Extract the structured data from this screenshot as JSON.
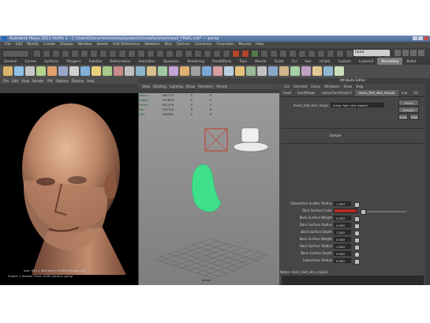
{
  "window": {
    "title": "Autodesk Maya 2011 Hotfix 1 · C:\\Users\\Documents\\maya\\projects\\head\\scenes\\head_FINAL.mb* — persp"
  },
  "menubar": [
    "File",
    "Edit",
    "Modify",
    "Create",
    "Display",
    "Window",
    "Assets",
    "Edit Deformers",
    "Skeleton",
    "Skin",
    "Deform",
    "Constrain",
    "Character",
    "Muscle",
    "Help"
  ],
  "status_line": {
    "mode": "Rendering",
    "input_value": "head"
  },
  "shelf_tabs": [
    "General",
    "Curves",
    "Surfaces",
    "Polygons",
    "Subdivs",
    "Deformation",
    "Animation",
    "Dynamics",
    "Rendering",
    "PaintEffects",
    "Toon",
    "Muscle",
    "Fluids",
    "Fur",
    "Hair",
    "nCloth",
    "Custom",
    "Custom2",
    "MentalRay",
    "Bullet"
  ],
  "shelf_active_tab": "MentalRay",
  "shelf_icon_colors": [
    "#d9b36a",
    "#8fc2e6",
    "#c7c7c7",
    "#b4d28a",
    "#e0a06a",
    "#9aa6c9",
    "#cfcfcf",
    "#7fb0d8",
    "#e8d07a",
    "#a8c98a",
    "#c98a8a",
    "#bfbfbf",
    "#8ab4c9",
    "#d7c08c",
    "#9fc99f",
    "#c4a4d8",
    "#e0b070",
    "#a0a0a0",
    "#7aa8d6",
    "#d8a0a0",
    "#b8d0e0",
    "#e6c27a",
    "#9ab89a",
    "#c0c0c0",
    "#88a8c8",
    "#d2b48c",
    "#a6d0a6",
    "#c0a0c0",
    "#e0c890",
    "#8fb8d0",
    "#cdb"
  ],
  "render_view": {
    "menu": [
      "File",
      "Edit",
      "View",
      "Render",
      "IPR",
      "Options",
      "Display",
      "Help"
    ],
    "hud_line1": "size: 640 x 480  zoom: 0.530  (mental ray)",
    "hud_line2": "Frame: 1   Render Time: 0:08   Camera: persp"
  },
  "viewport": {
    "menu": [
      "View",
      "Shading",
      "Lighting",
      "Show",
      "Renderer",
      "Panels"
    ],
    "stats": [
      {
        "name": "Verts:",
        "a": "161174",
        "b": "0",
        "c": "0"
      },
      {
        "name": "Edges:",
        "a": "322848",
        "b": "0",
        "c": "0"
      },
      {
        "name": "Faces:",
        "a": "161476",
        "b": "0",
        "c": "0"
      },
      {
        "name": "Tris:",
        "a": "322744",
        "b": "0",
        "c": "0"
      },
      {
        "name": "UVs:",
        "a": "166580",
        "b": "0",
        "c": "0"
      }
    ],
    "camera_label": "persp",
    "colors": {
      "mesh": "#3fe08a",
      "light_box": "#b84a3a"
    }
  },
  "attribute_editor": {
    "title": "Attribute Editor",
    "menu": [
      "List",
      "Selected",
      "Focus",
      "Attributes",
      "Show",
      "Help"
    ],
    "tabs": [
      "head",
      "headShape",
      "subsurfaceShader1",
      "misss_fast_skin_maya1",
      "mia",
      "SG"
    ],
    "active_tab": "misss_fast_skin_maya1",
    "node_label": "misss_fast_skin_maya:",
    "node_value": "misss_fast_skin_maya1",
    "buttons": {
      "focus": "Focus",
      "presets": "Presets",
      "show": "Show",
      "hide": "Hide"
    },
    "sample_label": "Sample",
    "attrs": [
      {
        "label": "Subsurface Scatter Radius",
        "value": "1.000"
      },
      {
        "label": "Back Surface Color",
        "value": ""
      },
      {
        "label": "Back Surface Weight",
        "value": "0.450"
      },
      {
        "label": "Back Surface Radius",
        "value": "4.000"
      },
      {
        "label": "Back Surface Depth",
        "value": "1.000"
      },
      {
        "label": "Back Surface Weight",
        "value": "0.000"
      },
      {
        "label": "Back Surface Radius",
        "value": "1.000"
      },
      {
        "label": "Back Surface Depth",
        "value": "0.500"
      },
      {
        "label": "Subsurface Radius",
        "value": "0.000"
      }
    ],
    "back_surface_color": "#b22a1e",
    "notes_label": "Notes:  misss_fast_skin_maya1",
    "bottom_buttons": [
      "Select",
      "Load Attributes",
      "Copy Tab"
    ]
  }
}
